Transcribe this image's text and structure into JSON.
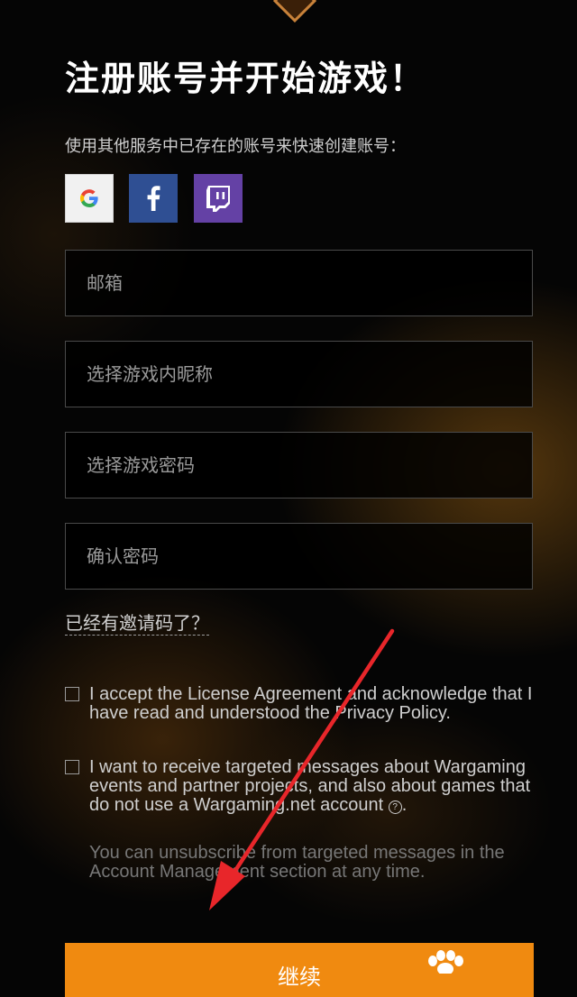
{
  "heading": "注册账号并开始游戏！",
  "social": {
    "label": "使用其他服务中已存在的账号来快速创建账号：",
    "buttons": [
      {
        "name": "google",
        "icon": "google-icon",
        "bg": "#f1f1f1"
      },
      {
        "name": "facebook",
        "icon": "facebook-icon",
        "bg": "#2f4f93"
      },
      {
        "name": "twitch",
        "icon": "twitch-icon",
        "bg": "#6441a5"
      }
    ]
  },
  "form": {
    "email_placeholder": "邮箱",
    "nickname_placeholder": "选择游戏内昵称",
    "password_placeholder": "选择游戏密码",
    "confirm_placeholder": "确认密码",
    "invite_link": "已经有邀请码了？"
  },
  "agreements": {
    "license_text": "I accept the License Agreement and acknowledge that I have read and understood the Privacy Policy.",
    "marketing_text": "I want to receive targeted messages about Wargaming events and partner projects, and also about games that do not use a Wargaming.net account",
    "help_icon": "question-circle-icon",
    "unsubscribe_note": "You can unsubscribe from targeted messages in the Account Management section at any time."
  },
  "submit": {
    "label": "继续",
    "icon": "paw-icon",
    "color": "#f08a10"
  },
  "annotation": {
    "arrow_color": "#e8262a"
  }
}
